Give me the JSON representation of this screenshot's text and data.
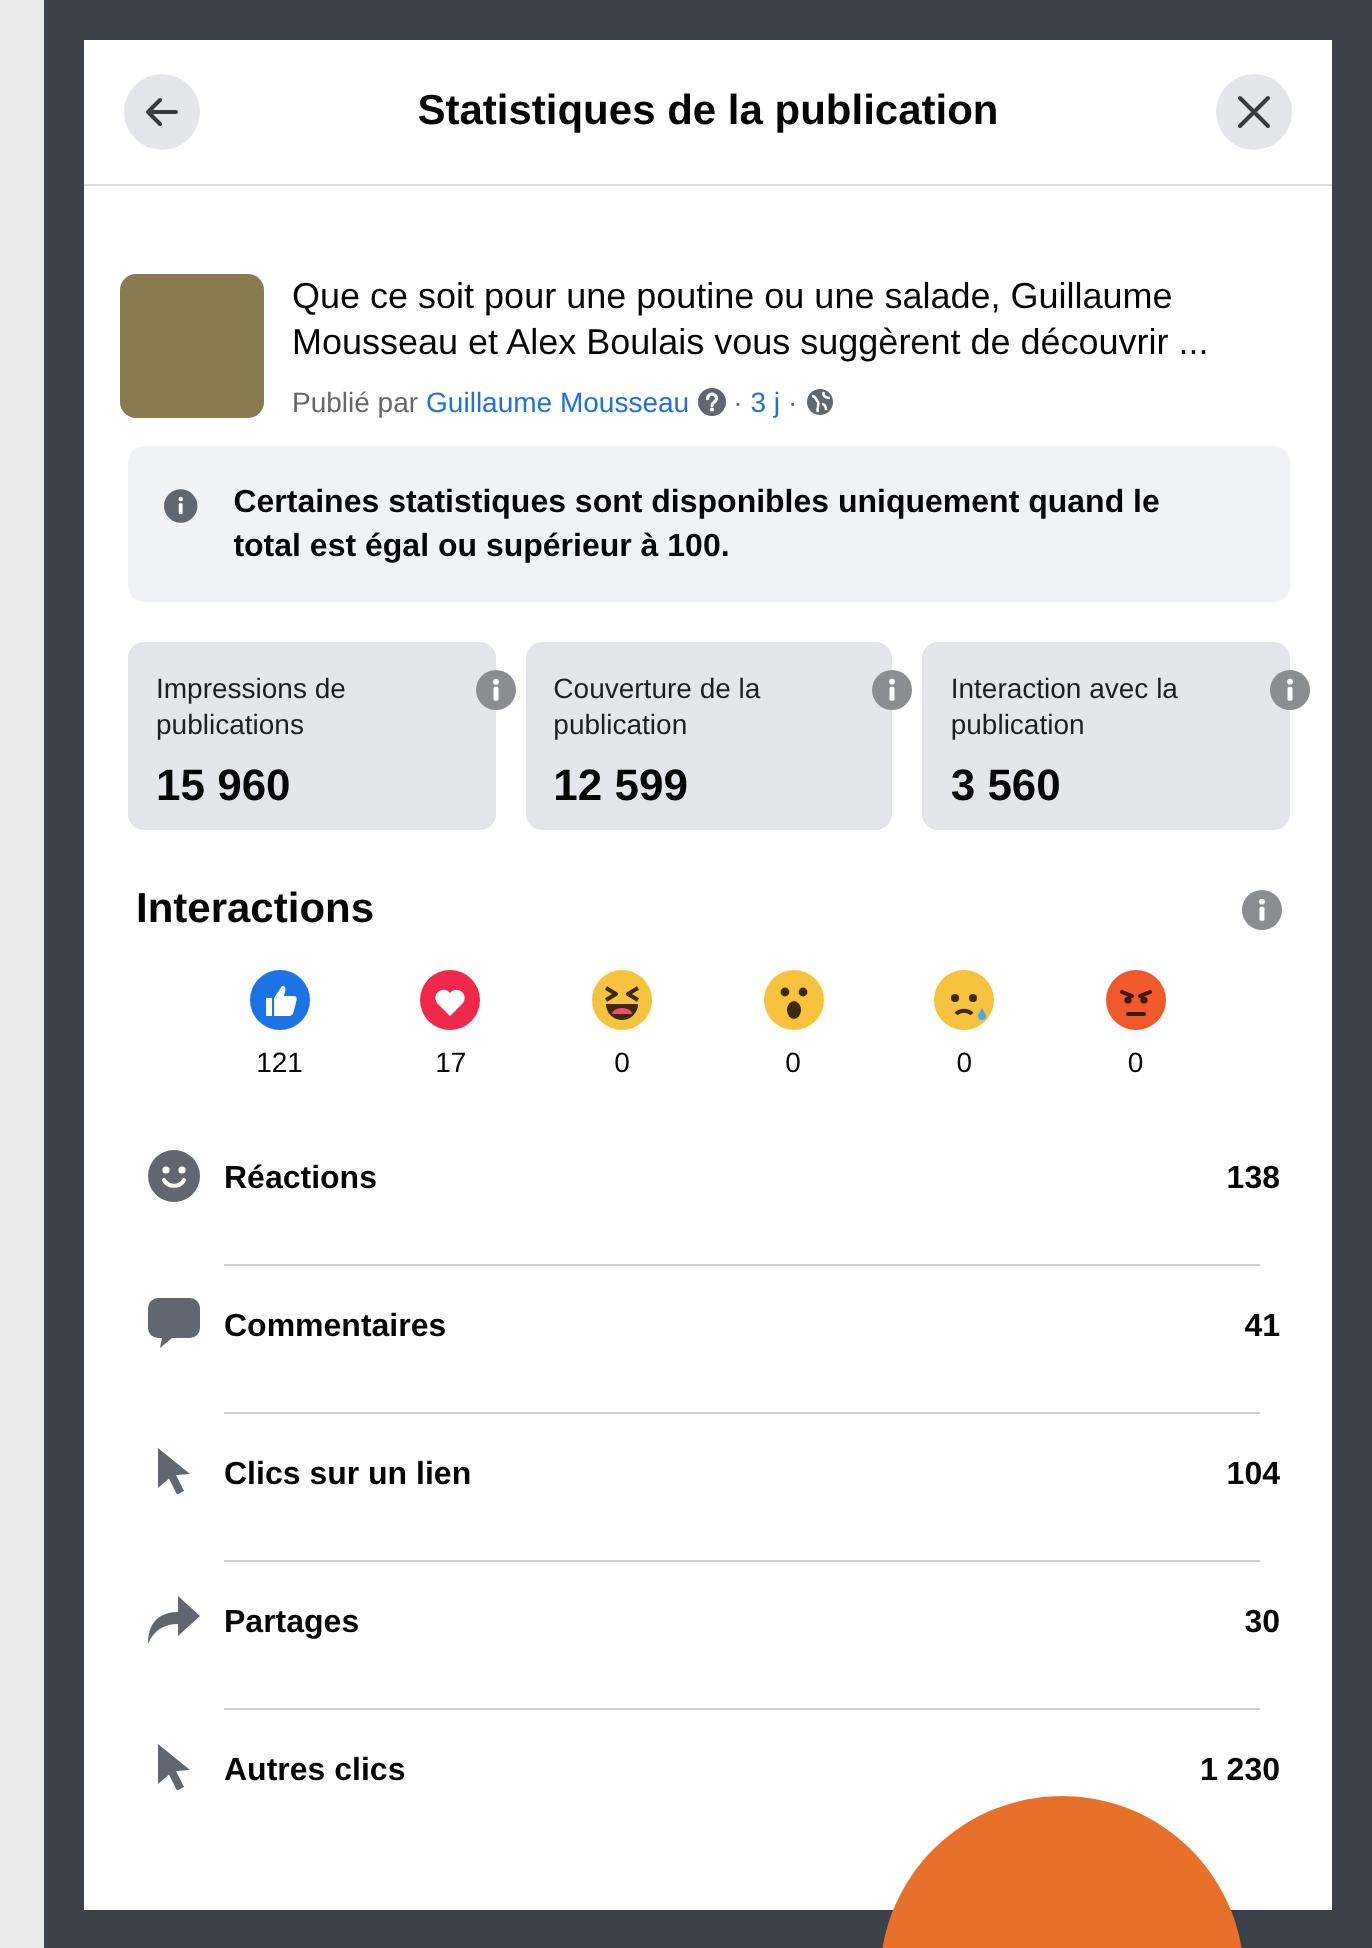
{
  "header": {
    "title": "Statistiques de la publication"
  },
  "post": {
    "text": "Que ce soit pour une poutine ou une salade, Guillaume Mousseau et Alex Boulais vous suggèrent de découvrir ...",
    "published_by": "Publié par",
    "author": "Guillaume Mousseau",
    "age": "3 j",
    "separator": "·"
  },
  "notice": {
    "text": "Certaines statistiques sont disponibles uniquement quand le total est égal ou supérieur à 100."
  },
  "stat_cards": [
    {
      "label": "Impressions de publications",
      "value": "15 960"
    },
    {
      "label": "Couverture de la publication",
      "value": "12 599"
    },
    {
      "label": "Interaction avec la publication",
      "value": "3 560"
    }
  ],
  "interactions": {
    "title": "Interactions",
    "reactions": [
      {
        "kind": "like",
        "count": "121"
      },
      {
        "kind": "love",
        "count": "17"
      },
      {
        "kind": "haha",
        "count": "0"
      },
      {
        "kind": "wow",
        "count": "0"
      },
      {
        "kind": "sad",
        "count": "0"
      },
      {
        "kind": "angry",
        "count": "0"
      }
    ],
    "metrics": [
      {
        "kind": "smile",
        "label": "Réactions",
        "value": "138"
      },
      {
        "kind": "comment",
        "label": "Commentaires",
        "value": "41"
      },
      {
        "kind": "cursor",
        "label": "Clics sur un lien",
        "value": "104"
      },
      {
        "kind": "share",
        "label": "Partages",
        "value": "30"
      },
      {
        "kind": "cursor",
        "label": "Autres clics",
        "value": "1 230"
      }
    ]
  }
}
